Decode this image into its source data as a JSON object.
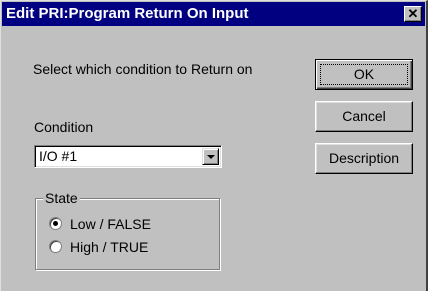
{
  "window": {
    "title": "Edit PRI:Program Return On Input",
    "close_glyph": "✕"
  },
  "prompt": "Select which condition to Return on",
  "condition": {
    "label": "Condition",
    "selected": "I/O #1"
  },
  "state": {
    "legend": "State",
    "options": [
      {
        "label": "Low / FALSE",
        "checked": true
      },
      {
        "label": "High / TRUE",
        "checked": false
      }
    ]
  },
  "buttons": {
    "ok": "OK",
    "cancel": "Cancel",
    "description": "Description"
  },
  "colors": {
    "face": "#c0c0c0",
    "titlebar": "#000080"
  }
}
